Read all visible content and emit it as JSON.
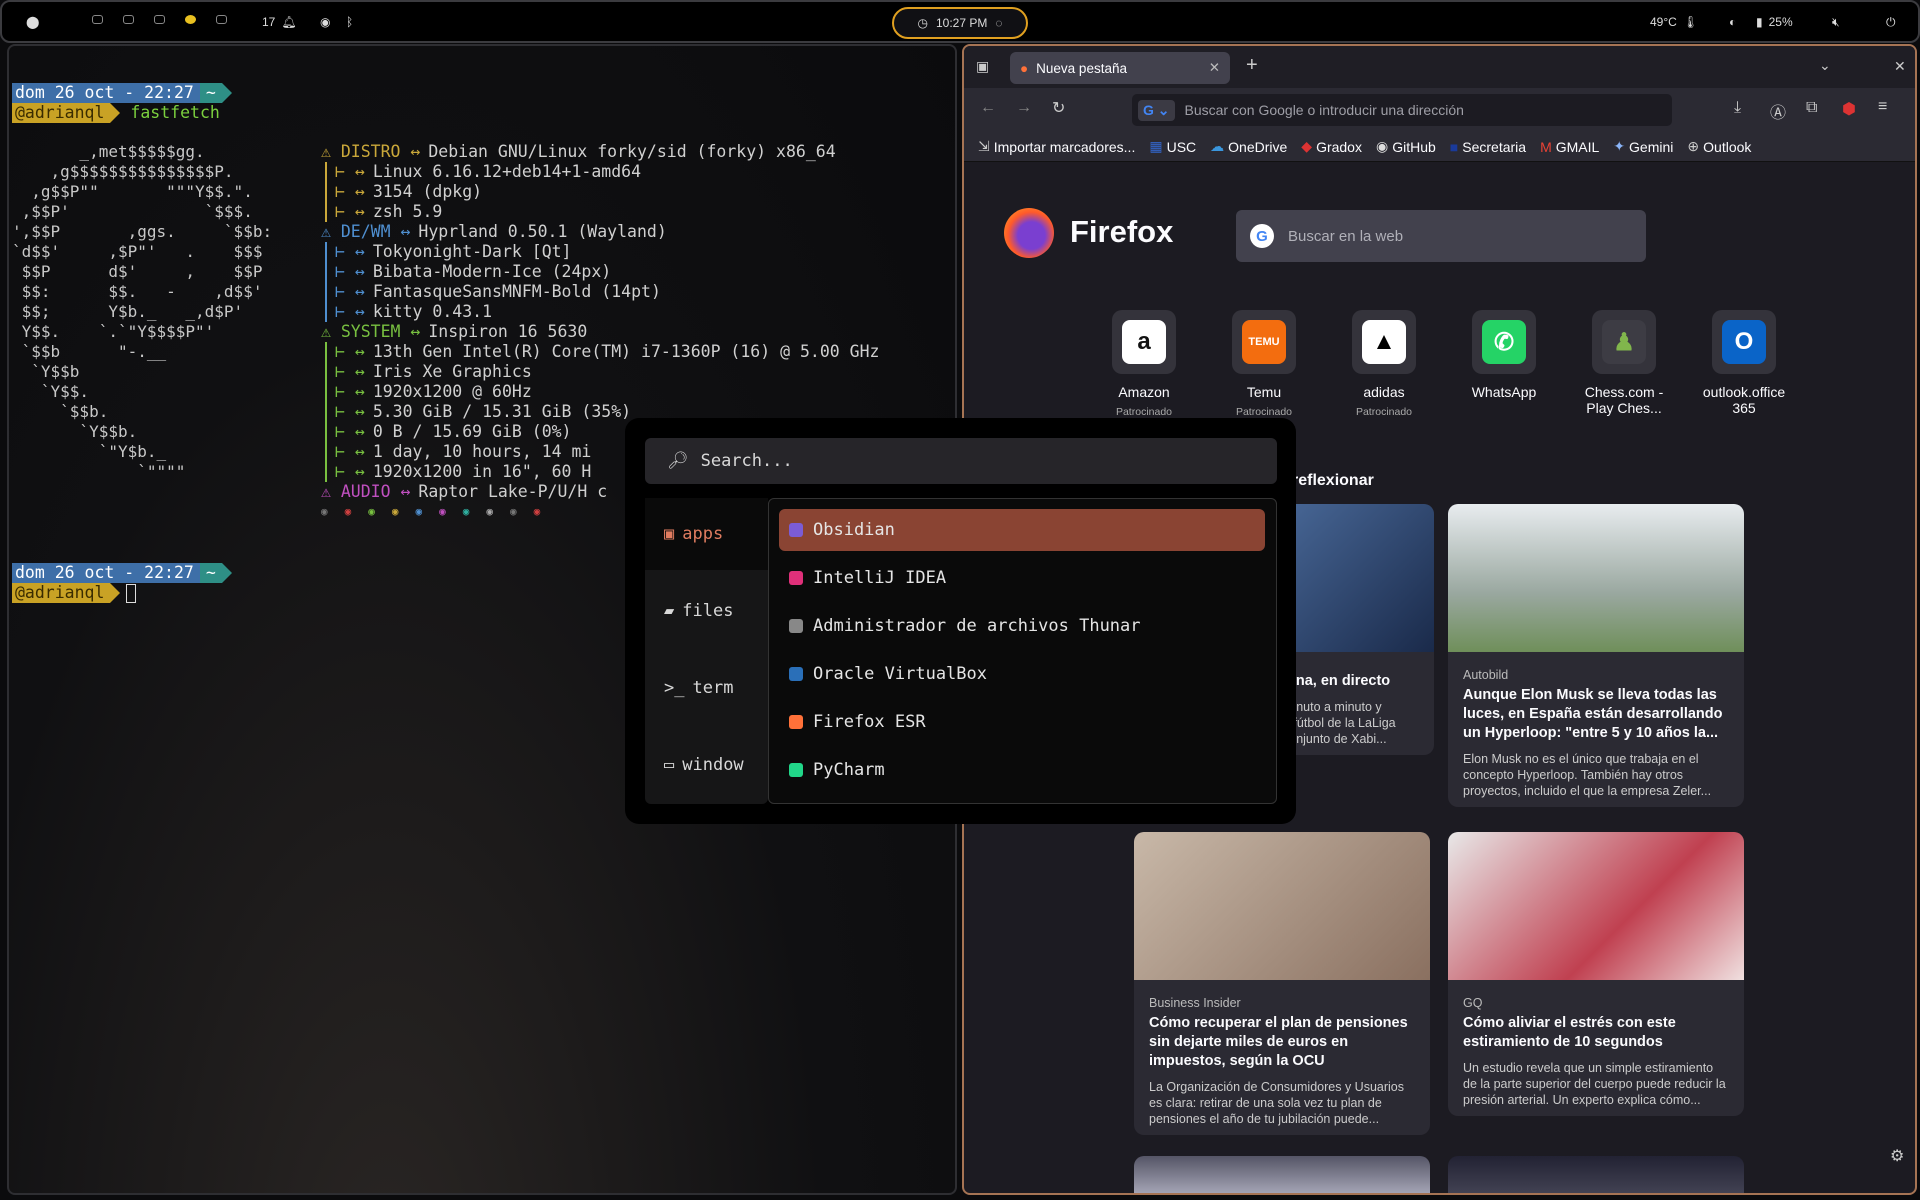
{
  "topbar": {
    "workspace_num": "17",
    "clock": "10:27 PM",
    "temp": "49°C",
    "brightness_icon": "half-moon-icon",
    "battery": "25%"
  },
  "terminal": {
    "prompt1": {
      "date": "dom 26 oct - 22:27",
      "dir": "~",
      "user": "@adrianql",
      "cmd": "fastfetch"
    },
    "prompt2": {
      "date": "dom 26 oct - 22:27",
      "dir": "~",
      "user": "@adrianql"
    },
    "logo": "       _,met$$$$$gg.\n    ,g$$$$$$$$$$$$$$$P.\n  ,g$$P\"\"       \"\"\"Y$$.\".\n ,$$P'              `$$$.\n',$$P       ,ggs.     `$$b:\n`d$$'     ,$P\"'   .    $$$\n $$P      d$'     ,    $$P\n $$:      $$.   -    ,d$$'\n $$;      Y$b._   _,d$P'\n Y$$.    `.`\"Y$$$$P\"'\n `$$b      \"-.__\n  `Y$$b\n   `Y$$.\n     `$$b.\n       `Y$$b.\n         `\"Y$b._\n             `\"\"\"\"",
    "lines": [
      {
        "k": "DISTRO",
        "v": "Debian GNU/Linux forky/sid (forky) x86_64",
        "c": ""
      },
      {
        "k": "",
        "v": "Linux 6.16.12+deb14+1-amd64",
        "c": ""
      },
      {
        "k": "",
        "v": "3154 (dpkg)",
        "c": ""
      },
      {
        "k": "",
        "v": "zsh 5.9",
        "c": ""
      },
      {
        "k": "DE/WM",
        "v": "Hyprland 0.50.1 (Wayland)",
        "c": "b"
      },
      {
        "k": "",
        "v": "Tokyonight-Dark [Qt]",
        "c": "b"
      },
      {
        "k": "",
        "v": "Bibata-Modern-Ice (24px)",
        "c": "b"
      },
      {
        "k": "",
        "v": "FantasqueSansMNFM-Bold (14pt)",
        "c": "b"
      },
      {
        "k": "",
        "v": "kitty 0.43.1",
        "c": "b"
      },
      {
        "k": "SYSTEM",
        "v": "Inspiron 16 5630",
        "c": "g"
      },
      {
        "k": "",
        "v": "13th Gen Intel(R) Core(TM) i7-1360P (16) @ 5.00 GHz",
        "c": "g"
      },
      {
        "k": "",
        "v": "Iris Xe Graphics",
        "c": "g"
      },
      {
        "k": "",
        "v": "1920x1200 @ 60Hz",
        "c": "g"
      },
      {
        "k": "",
        "v": "5.30 GiB / 15.31 GiB (35%)",
        "c": "g"
      },
      {
        "k": "",
        "v": "0 B / 15.69 GiB (0%)",
        "c": "g"
      },
      {
        "k": "",
        "v": "1 day, 10 hours, 14 mi",
        "c": "g"
      },
      {
        "k": "",
        "v": "1920x1200 in 16\", 60 H",
        "c": "g"
      },
      {
        "k": "AUDIO",
        "v": "Raptor Lake-P/U/H c",
        "c": "m"
      }
    ]
  },
  "firefox": {
    "tab_title": "Nueva pestaña",
    "url_placeholder": "Buscar con Google o introducir una dirección",
    "bookmarks": [
      "Importar marcadores...",
      "USC",
      "OneDrive",
      "Gradox",
      "GitHub",
      "Secretaria",
      "GMAIL",
      "Gemini",
      "Outlook"
    ],
    "brand": "Firefox",
    "search_placeholder": "Buscar en la web",
    "shortcuts": [
      {
        "name": "Amazon",
        "sponsor": "Patrocinado",
        "glyph": "a",
        "bg": "#ffffff",
        "fg": "#111"
      },
      {
        "name": "Temu",
        "sponsor": "Patrocinado",
        "glyph": "TEMU",
        "bg": "#f36d0f",
        "fg": "#fff"
      },
      {
        "name": "adidas",
        "sponsor": "Patrocinado",
        "glyph": "▲",
        "bg": "#ffffff",
        "fg": "#000"
      },
      {
        "name": "WhatsApp",
        "sponsor": "",
        "glyph": "✆",
        "bg": "#25d366",
        "fg": "#fff"
      },
      {
        "name": "Chess.com -",
        "name2": "Play Ches...",
        "sponsor": "",
        "glyph": "♟",
        "bg": "#3d3c44",
        "fg": "#81b64c"
      },
      {
        "name": "outlook.office",
        "name2": "365",
        "sponsor": "",
        "glyph": "O",
        "bg": "#0a64c8",
        "fg": "#fff"
      }
    ],
    "section_title": "reflexionar",
    "stories": [
      {
        "source": "",
        "title": "lona, en directo",
        "desc": "minuto a minuto y\ne fútbol de la LaLiga\nconjunto de Xabi..."
      },
      {
        "source": "Autobild",
        "title": "Aunque Elon Musk se lleva todas las luces, en España están desarrollando un Hyperloop: \"entre 5 y 10 años la...",
        "desc": "Elon Musk no es el único que trabaja en el concepto Hyperloop. También hay otros proyectos, incluido el que la empresa Zeler..."
      },
      {
        "source": "Business Insider",
        "title": "Cómo recuperar el plan de pensiones sin dejarte miles de euros en impuestos, según la OCU",
        "desc": "La Organización de Consumidores y Usuarios es clara: retirar de una sola vez tu plan de pensiones el año de tu jubilación puede..."
      },
      {
        "source": "GQ",
        "title": "Cómo aliviar el estrés con este estiramiento de 10 segundos",
        "desc": "Un estudio revela que un simple estiramiento de la parte superior del cuerpo puede reducir la presión arterial. Un experto explica cómo..."
      }
    ]
  },
  "launcher": {
    "search_placeholder": "Search...",
    "categories": [
      "apps",
      "files",
      "term",
      "window"
    ],
    "apps": [
      {
        "name": "Obsidian",
        "color": "#7b5cd6"
      },
      {
        "name": "IntelliJ IDEA",
        "color": "#e0307a"
      },
      {
        "name": "Administrador de archivos Thunar",
        "color": "#888"
      },
      {
        "name": "Oracle VirtualBox",
        "color": "#2a6fb8"
      },
      {
        "name": "Firefox ESR",
        "color": "#ff7139"
      },
      {
        "name": "PyCharm",
        "color": "#21d789"
      }
    ]
  }
}
